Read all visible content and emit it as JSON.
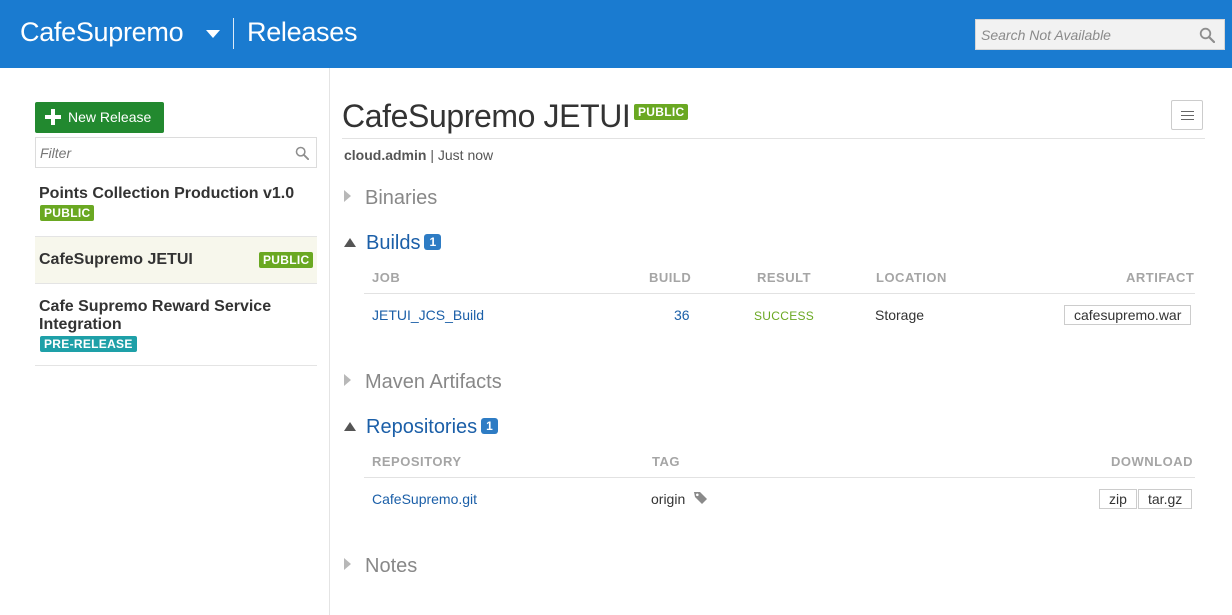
{
  "header": {
    "app_name": "CafeSupremo",
    "section": "Releases",
    "search_placeholder": "Search Not Available",
    "colors": {
      "bar": "#1a7bd0"
    },
    "icons": {
      "app_menu": "caret-down-icon",
      "search": "search-icon"
    }
  },
  "sidebar": {
    "new_release_label": "New Release",
    "filter_placeholder": "Filter",
    "releases": [
      {
        "title": "Points Collection Production v1.0",
        "badge": "PUBLIC"
      },
      {
        "title": "CafeSupremo JETUI",
        "badge": "PUBLIC",
        "selected": true
      },
      {
        "title": "Cafe Supremo Reward Service Integration",
        "badge": "PRE-RELEASE"
      }
    ]
  },
  "main": {
    "title": "CafeSupremo JETUI",
    "badge": "PUBLIC",
    "author": "cloud.admin",
    "separator": "|",
    "time": "Just now",
    "sections": {
      "binaries": {
        "label": "Binaries"
      },
      "builds": {
        "label": "Builds",
        "count": "1",
        "columns": [
          "JOB",
          "BUILD",
          "RESULT",
          "LOCATION",
          "ARTIFACT"
        ],
        "rows": [
          {
            "job": "JETUI_JCS_Build",
            "build": "36",
            "result": "SUCCESS",
            "location": "Storage",
            "artifact": "cafesupremo.war"
          }
        ]
      },
      "maven": {
        "label": "Maven Artifacts"
      },
      "repositories": {
        "label": "Repositories",
        "count": "1",
        "columns": [
          "REPOSITORY",
          "TAG",
          "DOWNLOAD"
        ],
        "rows": [
          {
            "repository": "CafeSupremo.git",
            "tag": "origin",
            "downloads": [
              "zip",
              "tar.gz"
            ]
          }
        ]
      },
      "notes": {
        "label": "Notes"
      }
    }
  }
}
